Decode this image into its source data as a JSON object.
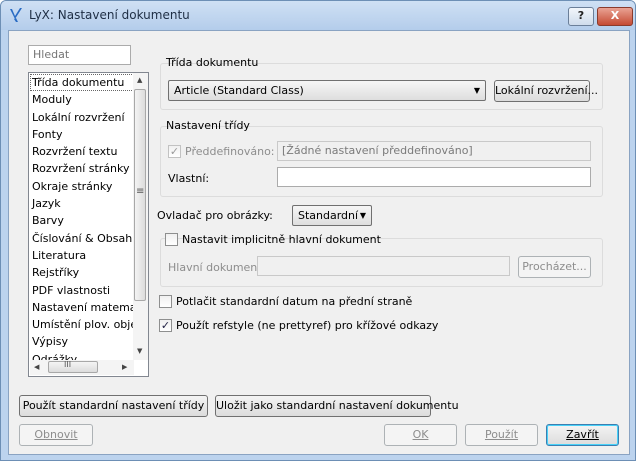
{
  "window": {
    "title": "LyX: Nastavení dokumentu",
    "help_button": "?",
    "close_button": "X"
  },
  "search": {
    "placeholder": "Hledat"
  },
  "nav": {
    "items": [
      "Třída dokumentu",
      "Moduly",
      "Lokální rozvržení",
      "Fonty",
      "Rozvržení textu",
      "Rozvržení stránky",
      "Okraje stránky",
      "Jazyk",
      "Barvy",
      "Číslování & Obsah",
      "Literatura",
      "Rejstříky",
      "PDF vlastnosti",
      "Nastavení matematiky",
      "Umístění plov. objektů",
      "Výpisy",
      "Odrážky"
    ],
    "selected_index": 0,
    "hscroll_grip": "III",
    "vscroll_grip": "≡"
  },
  "doc_class": {
    "group_label": "Třída dokumentu",
    "value": "Article (Standard Class)",
    "local_layout_button": "Lokální rozvržení..."
  },
  "class_options": {
    "group_label": "Nastavení třídy",
    "predefined_label": "Předdefinováno:",
    "predefined_value": "[Žádné nastavení předdefinováno]",
    "predefined_checked": true,
    "custom_label": "Vlastní:",
    "custom_value": ""
  },
  "graphics_driver": {
    "label": "Ovladač pro obrázky:",
    "value": "Standardní"
  },
  "master": {
    "checkbox_label": "Nastavit implicitně hlavní dokument",
    "checked": false,
    "field_label": "Hlavní dokument:",
    "field_value": "",
    "browse_button": "Procházet..."
  },
  "suppress_date": {
    "label": "Potlačit standardní datum na přední straně",
    "checked": false
  },
  "refstyle": {
    "label": "Použít refstyle (ne prettyref) pro křížové odkazy",
    "checked": true
  },
  "buttons": {
    "use_default": "Použít standardní nastavení třídy",
    "save_default": "Uložit jako standardní nastavení dokumentu",
    "restore": "Obnovit",
    "ok": "OK",
    "apply": "Použít",
    "close": "Zavřít"
  },
  "colors": {
    "titlebar": "#bcd3ee",
    "close": "#c54a33",
    "dialog_bg": "#f0f0f0"
  }
}
